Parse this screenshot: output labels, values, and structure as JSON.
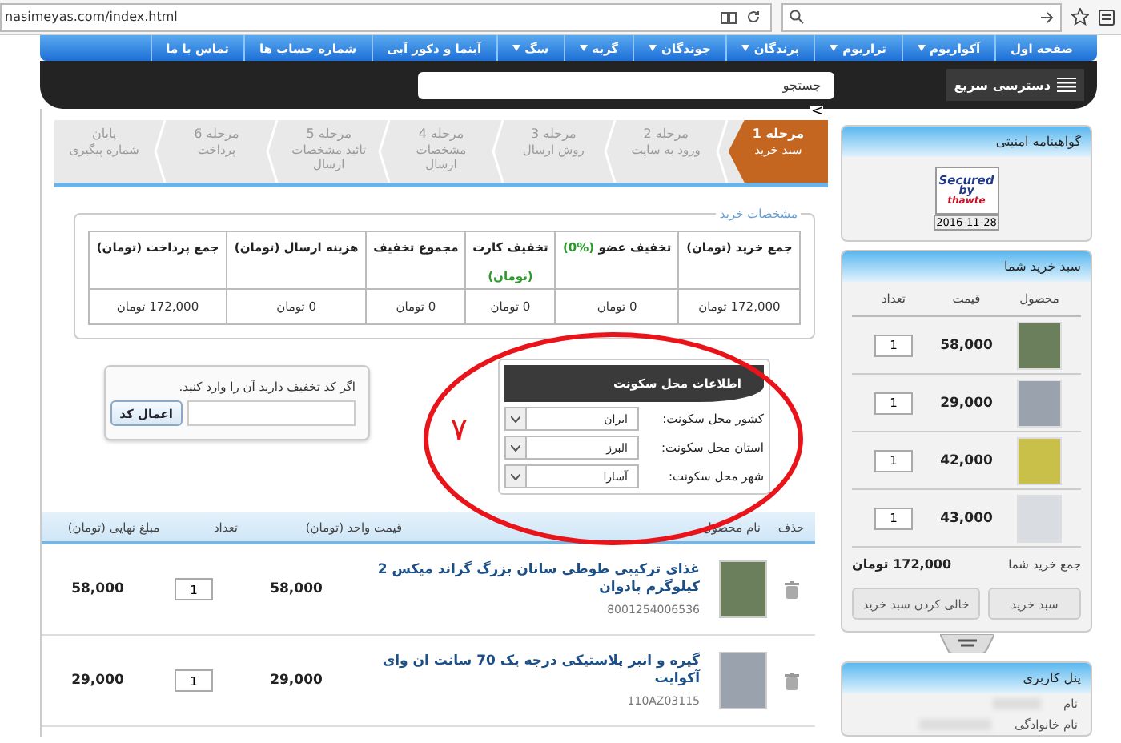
{
  "browser": {
    "url": "nasimeyas.com/index.html"
  },
  "nav": [
    {
      "label": "صفحه اول",
      "has_menu": false
    },
    {
      "label": "آکواریوم",
      "has_menu": true
    },
    {
      "label": "تراریوم",
      "has_menu": true
    },
    {
      "label": "پرندگان",
      "has_menu": true
    },
    {
      "label": "جوندگان",
      "has_menu": true
    },
    {
      "label": "گربه",
      "has_menu": true
    },
    {
      "label": "سگ",
      "has_menu": true
    },
    {
      "label": "آبنما و دکور آبی",
      "has_menu": false
    },
    {
      "label": "شماره حساب ها",
      "has_menu": false
    },
    {
      "label": "تماس با ما",
      "has_menu": false
    }
  ],
  "quick_access": {
    "label": "دسترسی سریع"
  },
  "search": {
    "placeholder": "جستجو"
  },
  "collapse_arrow": "<",
  "steps": [
    {
      "title": "مرحله 1",
      "subtitle": "سبد خرید",
      "selected": true
    },
    {
      "title": "مرحله 2",
      "subtitle": "ورود به سایت",
      "selected": false
    },
    {
      "title": "مرحله 3",
      "subtitle": "روش ارسال",
      "selected": false
    },
    {
      "title": "مرحله 4",
      "subtitle": "مشخصات ارسال",
      "selected": false
    },
    {
      "title": "مرحله 5",
      "subtitle": "تائید مشخصات ارسال",
      "selected": false
    },
    {
      "title": "مرحله 6",
      "subtitle": "پرداخت",
      "selected": false
    },
    {
      "title": "پایان",
      "subtitle": "شماره پیگیری",
      "selected": false
    }
  ],
  "summary": {
    "legend": "مشخصات خرید",
    "columns": [
      {
        "label": "جمع خرید (تومان)"
      },
      {
        "label": "تخفیف عضو",
        "note": "(%0)"
      },
      {
        "label": "تخفیف کارت",
        "note": "(تومان)"
      },
      {
        "label": "مجموع تخفیف"
      },
      {
        "label": "هزینه ارسال (تومان)"
      },
      {
        "label": "جمع پرداخت (تومان)"
      }
    ],
    "values": [
      "172,000 تومان",
      "0 تومان",
      "0 تومان",
      "0 تومان",
      "0 تومان",
      "172,000 تومان"
    ]
  },
  "residence": {
    "title": "اطلاعات محل سکونت",
    "fields": [
      {
        "label": "کشور محل سکونت:",
        "value": "ایران"
      },
      {
        "label": "استان محل سکونت:",
        "value": "البرز"
      },
      {
        "label": "شهر محل سکونت:",
        "value": "آسارا"
      }
    ]
  },
  "annotation": {
    "label": "۷"
  },
  "discount": {
    "prompt": "اگر کد تخفیف دارید آن را وارد کنید.",
    "button": "اعمال کد"
  },
  "products": {
    "columns": [
      "حذف",
      "نام محصول",
      "قیمت واحد (تومان)",
      "تعداد",
      "مبلغ نهایی (تومان)"
    ],
    "rows": [
      {
        "name": "غذای ترکیبی طوطی سانان بزرگ گراند میکس 2 کیلوگرم پادوان",
        "code": "8001254006536",
        "price": "58,000",
        "qty": "1",
        "total": "58,000"
      },
      {
        "name": "گیره و انبر پلاستیکی درجه یک 70 سانت ان وای آکوایت",
        "code": "110AZ03115",
        "price": "29,000",
        "qty": "1",
        "total": "29,000"
      }
    ]
  },
  "certificate": {
    "title": "گواهینامه امنیتی",
    "seal_lines": [
      "Secured",
      "by",
      "thawte"
    ],
    "seal_date": "2016-11-28"
  },
  "cart": {
    "title": "سبد خرید شما",
    "columns": [
      "محصول",
      "قیمت",
      "تعداد"
    ],
    "items": [
      {
        "price": "58,000",
        "qty": "1"
      },
      {
        "price": "29,000",
        "qty": "1"
      },
      {
        "price": "42,000",
        "qty": "1"
      },
      {
        "price": "43,000",
        "qty": "1"
      }
    ],
    "total_label": "جمع خرید شما",
    "total": "172,000 تومان",
    "buttons": [
      "سبد خرید",
      "خالی کردن سبد خرید"
    ]
  },
  "user_panel": {
    "title": "پنل کاربری",
    "fields": [
      {
        "label": "نام"
      },
      {
        "label": "نام خانوادگی"
      }
    ]
  }
}
